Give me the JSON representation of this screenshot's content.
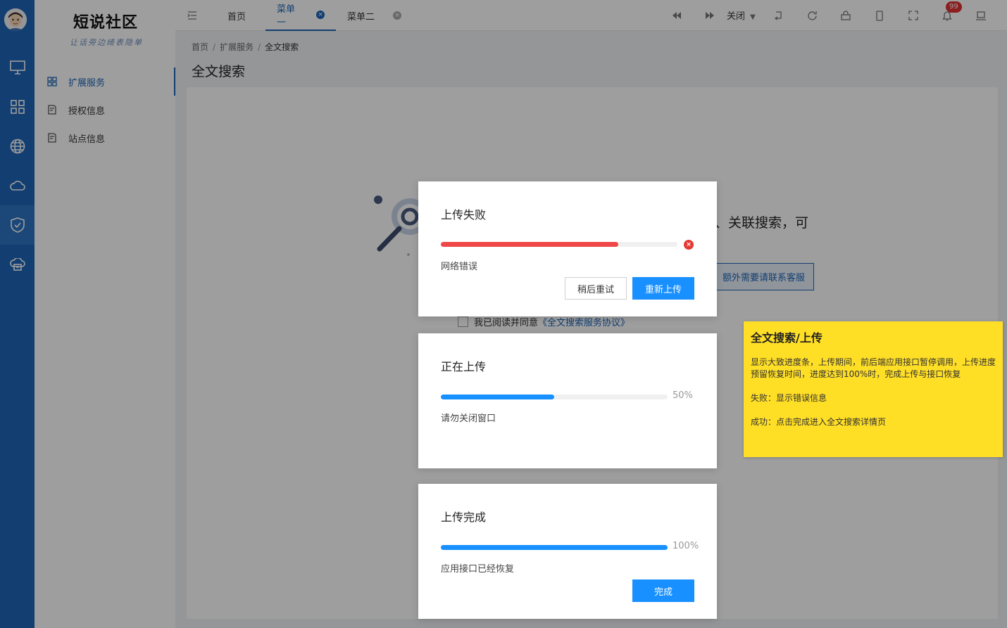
{
  "app": {
    "logo_title": "短说社区",
    "logo_subtitle": "让话旁边绮表隐单",
    "colors": {
      "brand": "#1d65b6",
      "primary": "#1890ff",
      "error": "#e53935",
      "note": "#ffde26"
    }
  },
  "rail": {
    "icons": [
      "monitor-icon",
      "grid-icon",
      "globe-icon",
      "cloud-icon",
      "shield-icon",
      "cloud-server-icon"
    ]
  },
  "sidebar": {
    "items": [
      {
        "label": "扩展服务",
        "icon": "app-grid-icon"
      },
      {
        "label": "授权信息",
        "icon": "document-icon"
      },
      {
        "label": "站点信息",
        "icon": "document-icon"
      }
    ]
  },
  "topbar": {
    "tabs": [
      {
        "label": "首页"
      },
      {
        "label": "菜单一"
      },
      {
        "label": "菜单二"
      }
    ],
    "close_label": "关闭",
    "notification_count": "99"
  },
  "breadcrumb": {
    "items": [
      "首页",
      "扩展服务",
      "全文搜索"
    ],
    "separator": "/"
  },
  "page": {
    "title": "全文搜索",
    "bg_text": "、关联搜索，可",
    "bg_button": "额外需要请联系客服",
    "agree_text": "我已阅读并同意",
    "agree_link": "《全文搜索服务协议》"
  },
  "dialogs": {
    "failed": {
      "title": "上传失败",
      "progress": 0.75,
      "message": "网络错误",
      "retry_later": "稍后重试",
      "reupload": "重新上传"
    },
    "uploading": {
      "title": "正在上传",
      "progress": 0.5,
      "percent_text": "50%",
      "message": "请勿关闭窗口"
    },
    "done": {
      "title": "上传完成",
      "progress": 1.0,
      "percent_text": "100%",
      "message": "应用接口已经恢复",
      "done_label": "完成"
    }
  },
  "note": {
    "title": "全文搜索/上传",
    "p1": "显示大致进度条，上传期间，前后端应用接口暂停调用，上传进度预留恢复时间，进度达到100%时，完成上传与接口恢复",
    "p2": "失败：显示错误信息",
    "p3": "成功：点击完成进入全文搜索详情页"
  }
}
